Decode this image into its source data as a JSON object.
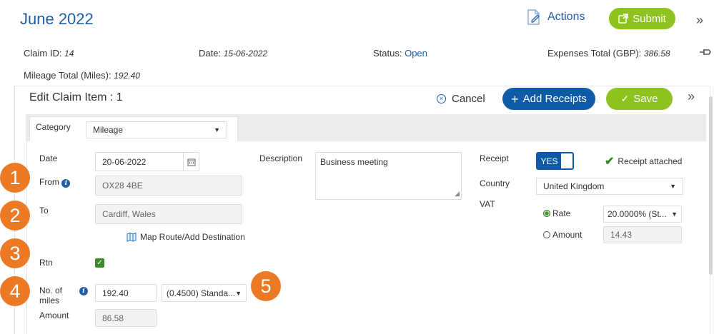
{
  "header": {
    "title": "June 2022",
    "actions_label": "Actions",
    "submit_label": "Submit"
  },
  "claim": {
    "id_label": "Claim ID:",
    "id_value": "14",
    "date_label": "Date:",
    "date_value": "15-06-2022",
    "status_label": "Status:",
    "status_value": "Open",
    "expenses_label": "Expenses Total (GBP):",
    "expenses_value": "386.58",
    "mileage_label": "Mileage Total (Miles):",
    "mileage_value": "192.40"
  },
  "panel": {
    "title": "Edit Claim Item : 1",
    "cancel_label": "Cancel",
    "add_receipts_label": "Add Receipts",
    "save_label": "Save"
  },
  "form": {
    "category_label": "Category",
    "category_value": "Mileage",
    "date_label": "Date",
    "date_value": "20-06-2022",
    "from_label": "From",
    "from_value": "OX28 4BE",
    "to_label": "To",
    "to_value": "Cardiff, Wales",
    "map_route_label": "Map Route/Add Destination",
    "rtn_label": "Rtn",
    "miles_label_line1": "No. of",
    "miles_label_line2": "miles",
    "miles_value": "192.40",
    "rate_select_value": "(0.4500) Standa...",
    "amount_label": "Amount",
    "amount_value": "86.58",
    "description_label": "Description",
    "description_value": "Business meeting",
    "receipt_label": "Receipt",
    "receipt_toggle": "YES",
    "receipt_attached": "Receipt attached",
    "country_label": "Country",
    "country_value": "United Kingdom",
    "vat_label": "VAT",
    "rate_label": "Rate",
    "rate_value": "20.0000% (St...",
    "vat_amount_label": "Amount",
    "vat_amount_value": "14.43"
  },
  "markers": [
    "1",
    "2",
    "3",
    "4",
    "5"
  ],
  "colors": {
    "primary_blue": "#1f5fa8",
    "button_blue": "#0d5aa7",
    "green": "#8dc21f",
    "marker_orange": "#ec7a25"
  }
}
